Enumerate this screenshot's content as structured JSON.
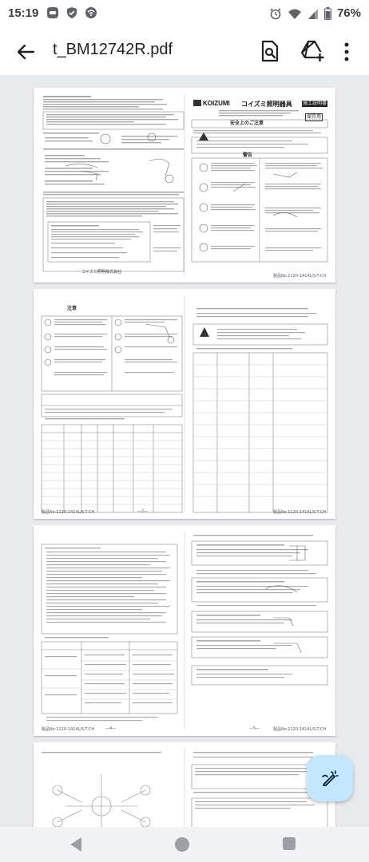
{
  "status_bar": {
    "time": "15:19",
    "battery": "76%"
  },
  "app_bar": {
    "title": "t_BM12742R.pdf"
  },
  "pdf": {
    "page1": {
      "brand_logo": "KOIZUMI",
      "brand_title": "コイズミ照明器具",
      "doc_label": "施工説明書",
      "badge": "保存用",
      "safety_heading": "安全上のご注意",
      "warning_label": "警告",
      "footer": "コイズミ照明株式会社",
      "page_code": "製品No.1120-1414L/S-T-CH"
    },
    "page2": {
      "caution_label": "注意",
      "page_code_left": "製品No.1120-1414L/S-T-CH",
      "page_num": "—2—",
      "page_code_right": "製品No.1120-1414L/S-T-CH"
    },
    "page3": {
      "page_code_left": "製品No.1120-1414L/S-T-CH",
      "page_num_left": "—4—",
      "page_num_right": "—5—",
      "page_code_right": "製品No.1120-1414L/S-T-CH"
    }
  }
}
